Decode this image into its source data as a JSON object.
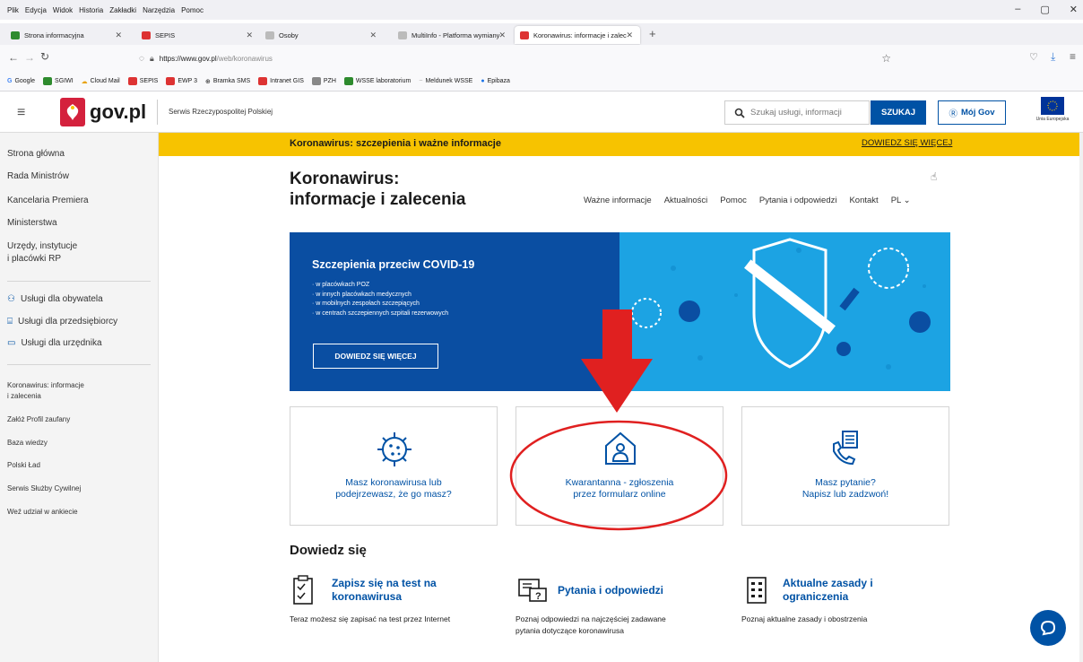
{
  "browser": {
    "menu": [
      "Plik",
      "Edycja",
      "Widok",
      "Historia",
      "Zakładki",
      "Narzędzia",
      "Pomoc"
    ],
    "tabs": [
      {
        "label": "Strona informacyjna",
        "color": "#2e8b2e"
      },
      {
        "label": "SEPIS",
        "color": "#d33"
      },
      {
        "label": "Osoby",
        "color": "#bbb"
      },
      {
        "label": "MultiInfo - Platforma wymiany info",
        "color": "#bbb"
      },
      {
        "label": "Koronawirus: informacje i zalec",
        "color": "#d33"
      }
    ],
    "url_host": "https://www.gov.pl",
    "url_path": "/web/koronawirus",
    "bookmarks": [
      "Google",
      "SGIWI",
      "Cloud Mail",
      "SEPIS",
      "EWP 3",
      "Bramka SMS",
      "Intranet GIS",
      "PZH",
      "WSSE laboratorium",
      "Meldunek WSSE",
      "Epibaza"
    ]
  },
  "header": {
    "logo": "gov.pl",
    "service": "Serwis Rzeczypospolitej Polskiej",
    "search_placeholder": "Szukaj usługi, informacji",
    "search_button": "SZUKAJ",
    "mojgov": "Mój Gov",
    "eu_label": "Unia Europejska"
  },
  "sidebar": {
    "main": [
      "Strona główna",
      "Rada Ministrów",
      "Kancelaria Premiera",
      "Ministerstwa"
    ],
    "urzedy_1": "Urzędy, instytucje",
    "urzedy_2": "i placówki RP",
    "services": [
      "Usługi dla obywatela",
      "Usługi dla przedsiębiorcy",
      "Usługi dla urzędnika"
    ],
    "links": [
      "Koronawirus: informacje",
      "i zalecenia",
      "Załóż Profil zaufany",
      "Baza wiedzy",
      "Polski Ład",
      "Serwis Służby Cywilnej",
      "Weź udział w ankiecie"
    ]
  },
  "banner": {
    "text": "Koronawirus: szczepienia i ważne informacje",
    "link": "DOWIEDZ SIĘ WIĘCEJ"
  },
  "page": {
    "title_1": "Koronawirus:",
    "title_2": "informacje i zalecenia",
    "nav": [
      "Ważne informacje",
      "Aktualności",
      "Pomoc",
      "Pytania i odpowiedzi",
      "Kontakt"
    ],
    "lang": "PL"
  },
  "hero": {
    "title": "Szczepienia przeciw COVID-19",
    "bullets": [
      "w placówkach POZ",
      "w innych placówkach medycznych",
      "w mobilnych zespołach szczepiących",
      "w centrach szczepiennych szpitali rezerwowych"
    ],
    "button": "DOWIEDZ SIĘ WIĘCEJ"
  },
  "cards": [
    {
      "l1": "Masz koronawirusa lub",
      "l2": "podejrzewasz, że go masz?",
      "icon": "virus-icon"
    },
    {
      "l1": "Kwarantanna - zgłoszenia",
      "l2": "przez formularz online",
      "icon": "house-person-icon"
    },
    {
      "l1": "Masz pytanie?",
      "l2": "Napisz lub zadzwoń!",
      "icon": "phone-icon"
    }
  ],
  "dowiedz": {
    "heading": "Dowiedz się",
    "items": [
      {
        "l1": "Zapisz się na test na",
        "l2": "koronawirusa",
        "t1": "Teraz możesz się zapisać na test przez Internet",
        "t2": ""
      },
      {
        "l1": "Pytania i odpowiedzi",
        "l2": "",
        "t1": "Poznaj odpowiedzi na najczęściej zadawane",
        "t2": "pytania dotyczące koronawirusa"
      },
      {
        "l1": "Aktualne zasady i",
        "l2": "ograniczenia",
        "t1": "Poznaj aktualne zasady i obostrzenia",
        "t2": ""
      }
    ]
  },
  "colors": {
    "gov_blue": "#0052a5",
    "banner_yellow": "#f7c300",
    "hero_left": "#0a4ea2",
    "hero_right": "#1ca3e3",
    "annotation_red": "#e02020"
  }
}
